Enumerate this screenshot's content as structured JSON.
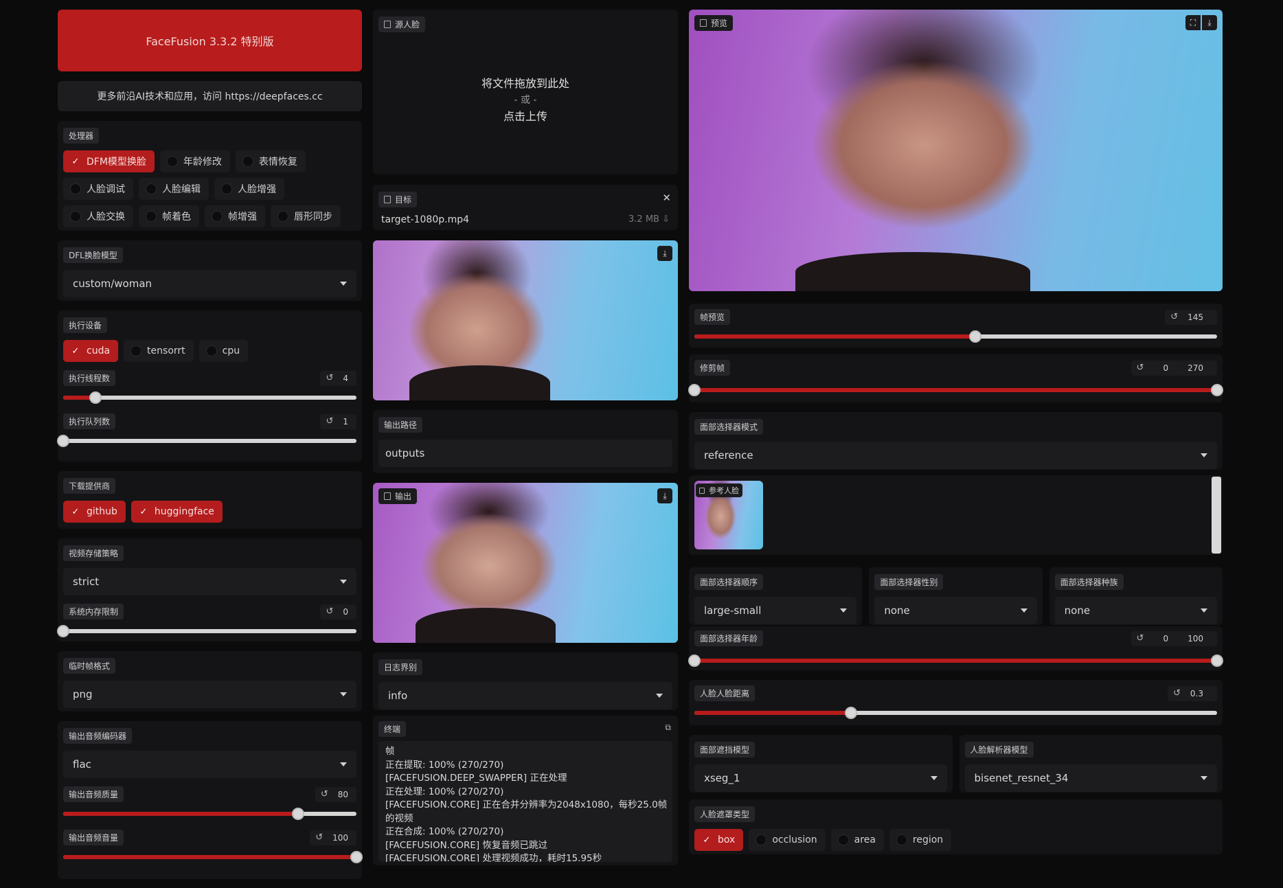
{
  "header": {
    "title": "FaceFusion 3.3.2 特别版",
    "note": "更多前沿AI技术和应用，访问 https://deepfaces.cc"
  },
  "processors": {
    "label": "处理器",
    "items": [
      {
        "label": "DFM模型换脸",
        "checked": true
      },
      {
        "label": "年龄修改",
        "checked": false
      },
      {
        "label": "表情恢复",
        "checked": false
      },
      {
        "label": "人脸调试",
        "checked": false
      },
      {
        "label": "人脸编辑",
        "checked": false
      },
      {
        "label": "人脸增强",
        "checked": false
      },
      {
        "label": "人脸交换",
        "checked": false
      },
      {
        "label": "帧着色",
        "checked": false
      },
      {
        "label": "帧增强",
        "checked": false
      },
      {
        "label": "唇形同步",
        "checked": false
      }
    ]
  },
  "dfl_model": {
    "label": "DFL换脸模型",
    "value": "custom/woman"
  },
  "execution": {
    "label": "执行设备",
    "providers": [
      {
        "label": "cuda",
        "checked": true
      },
      {
        "label": "tensorrt",
        "checked": false
      },
      {
        "label": "cpu",
        "checked": false
      }
    ],
    "threads": {
      "label": "执行线程数",
      "value": "4",
      "fraction": 0.11
    },
    "queue": {
      "label": "执行队列数",
      "value": "1",
      "fraction": 0.0
    }
  },
  "download": {
    "label": "下载提供商",
    "providers": [
      {
        "label": "github",
        "checked": true
      },
      {
        "label": "huggingface",
        "checked": true
      }
    ]
  },
  "video_memory": {
    "label": "视频存储策略",
    "value": "strict"
  },
  "system_memory": {
    "label": "系统内存限制",
    "value": "0",
    "fraction": 0.0
  },
  "temp_frame": {
    "label": "临时帧格式",
    "value": "png"
  },
  "audio_encoder": {
    "label": "输出音频编码器",
    "value": "flac"
  },
  "audio_quality": {
    "label": "输出音频质量",
    "value": "80",
    "fraction": 0.8
  },
  "audio_volume": {
    "label": "输出音频音量",
    "value": "100",
    "fraction": 1.0
  },
  "source": {
    "label": "源人脸",
    "drop_line1": "将文件拖放到此处",
    "drop_line2": "- 或 -",
    "drop_line3": "点击上传"
  },
  "target": {
    "label": "目标",
    "filename": "target-1080p.mp4",
    "size": "3.2 MB ⇩",
    "close": "✕"
  },
  "output_path": {
    "label": "输出路径",
    "value": "outputs"
  },
  "output": {
    "label": "输出"
  },
  "log_level": {
    "label": "日志界别",
    "value": "info"
  },
  "terminal": {
    "label": "终端",
    "lines": [
      "帧",
      "正在提取: 100% (270/270)",
      "[FACEFUSION.DEEP_SWAPPER] 正在处理",
      "正在处理: 100% (270/270)",
      "[FACEFUSION.CORE] 正在合并分辨率为2048x1080，每秒25.0帧",
      "的视频",
      "正在合成: 100% (270/270)",
      "[FACEFUSION.CORE] 恢复音频已跳过",
      "[FACEFUSION.CORE] 处理视频成功，耗时15.95秒"
    ]
  },
  "preview": {
    "label": "预览"
  },
  "frame_preview": {
    "label": "帧预览",
    "value": "145",
    "fraction": 0.537
  },
  "trim_frame": {
    "label": "修剪帧",
    "start": "0",
    "end": "270",
    "start_fraction": 0.0,
    "end_fraction": 1.0
  },
  "face_selector_mode": {
    "label": "面部选择器模式",
    "value": "reference"
  },
  "reference_face": {
    "label": "参考人脸"
  },
  "face_selector_order": {
    "label": "面部选择器顺序",
    "value": "large-small"
  },
  "face_selector_gender": {
    "label": "面部选择器性别",
    "value": "none"
  },
  "face_selector_race": {
    "label": "面部选择器种族",
    "value": "none"
  },
  "face_selector_age": {
    "label": "面部选择器年龄",
    "start": "0",
    "end": "100",
    "start_fraction": 0.0,
    "end_fraction": 1.0
  },
  "face_distance": {
    "label": "人脸人脸距离",
    "value": "0.3",
    "fraction": 0.3
  },
  "face_occluder": {
    "label": "面部遮挡模型",
    "value": "xseg_1"
  },
  "face_parser": {
    "label": "人脸解析器模型",
    "value": "bisenet_resnet_34"
  },
  "face_mask_types": {
    "label": "人脸遮罩类型",
    "items": [
      {
        "label": "box",
        "checked": true
      },
      {
        "label": "occlusion",
        "checked": false
      },
      {
        "label": "area",
        "checked": false
      },
      {
        "label": "region",
        "checked": false
      }
    ]
  },
  "colors": {
    "accent": "#b81c1c",
    "panel": "#141416",
    "background": "#0b0b0c"
  }
}
